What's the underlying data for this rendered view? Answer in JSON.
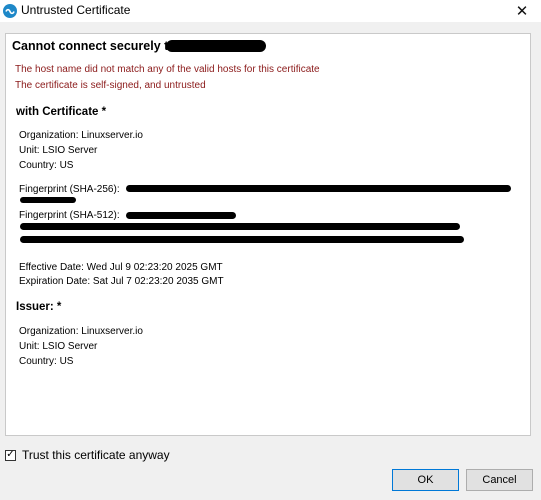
{
  "window": {
    "title": "Untrusted Certificate",
    "close_glyph": "✕"
  },
  "dialog": {
    "heading": "Cannot connect securely to",
    "errors": [
      "The host name did not match any of the valid hosts for this certificate",
      "The certificate is self-signed, and untrusted"
    ],
    "certificate": {
      "title": "with Certificate *",
      "organization": "Organization: Linuxserver.io",
      "unit": "Unit: LSIO Server",
      "country": "Country: US",
      "fp256_label": "Fingerprint (SHA-256):",
      "fp512_label": "Fingerprint (SHA-512):",
      "effective": "Effective Date: Wed Jul 9 02:23:20 2025 GMT",
      "expiration": "Expiration Date: Sat Jul 7 02:23:20 2035 GMT"
    },
    "issuer": {
      "title": "Issuer: *",
      "organization": "Organization: Linuxserver.io",
      "unit": "Unit: LSIO Server",
      "country": "Country: US"
    }
  },
  "trust": {
    "label": "Trust this certificate anyway",
    "checked": true,
    "check_glyph": "✓"
  },
  "buttons": {
    "ok": "OK",
    "cancel": "Cancel"
  },
  "colors": {
    "error_text": "#8b1a1a",
    "app_icon": "#1e88c8",
    "ok_border": "#0078d7"
  }
}
